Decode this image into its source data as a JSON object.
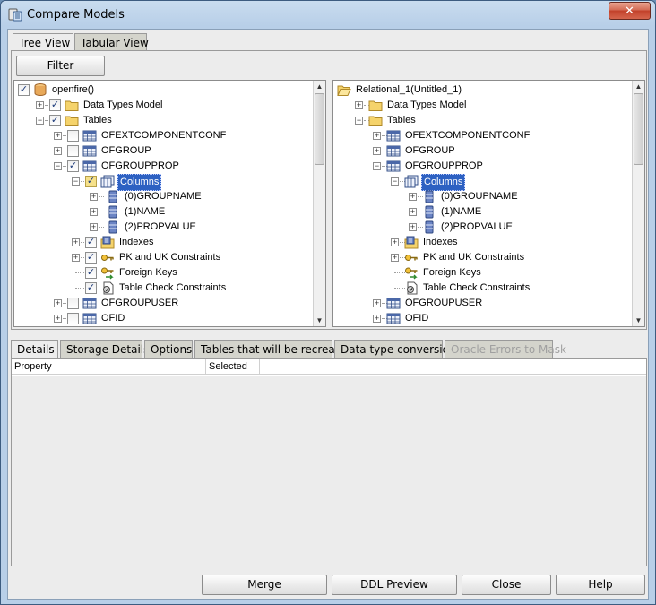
{
  "window": {
    "title": "Compare Models",
    "close_label": "✕"
  },
  "top_tabs": [
    {
      "label": "Tree View",
      "active": true
    },
    {
      "label": "Tabular View",
      "active": false
    }
  ],
  "filter_label": "Filter",
  "left_tree": [
    {
      "label": "openfire()",
      "check": "checked",
      "icon": "db-icon"
    },
    {
      "label": "Data Types Model",
      "check": "checked",
      "icon": "folder-icon"
    },
    {
      "label": "Tables",
      "check": "checked",
      "icon": "folder-icon"
    },
    {
      "label": "OFEXTCOMPONENTCONF",
      "check": "unchecked",
      "icon": "table-icon"
    },
    {
      "label": "OFGROUP",
      "check": "unchecked",
      "icon": "table-icon"
    },
    {
      "label": "OFGROUPPROP",
      "check": "checked",
      "icon": "table-icon"
    },
    {
      "label": "Columns",
      "check": "checked-yellow",
      "icon": "columns-icon",
      "selected": true
    },
    {
      "label": "(0)GROUPNAME",
      "icon": "column-icon"
    },
    {
      "label": "(1)NAME",
      "icon": "column-icon"
    },
    {
      "label": "(2)PROPVALUE",
      "icon": "column-icon"
    },
    {
      "label": "Indexes",
      "check": "checked",
      "icon": "index-icon"
    },
    {
      "label": "PK and UK Constraints",
      "check": "checked",
      "icon": "key-icon"
    },
    {
      "label": "Foreign Keys",
      "check": "checked",
      "icon": "foreign-key-icon"
    },
    {
      "label": "Table Check Constraints",
      "check": "checked",
      "icon": "check-constraint-icon"
    },
    {
      "label": "OFGROUPUSER",
      "check": "unchecked",
      "icon": "table-icon"
    },
    {
      "label": "OFID",
      "check": "unchecked",
      "icon": "table-icon"
    }
  ],
  "right_tree": [
    {
      "label": "Relational_1(Untitled_1)",
      "icon": "open-folder-icon"
    },
    {
      "label": "Data Types Model",
      "icon": "folder-icon"
    },
    {
      "label": "Tables",
      "icon": "folder-icon"
    },
    {
      "label": "OFEXTCOMPONENTCONF",
      "icon": "table-icon"
    },
    {
      "label": "OFGROUP",
      "icon": "table-icon"
    },
    {
      "label": "OFGROUPPROP",
      "icon": "table-icon"
    },
    {
      "label": "Columns",
      "icon": "columns-icon",
      "selected": true
    },
    {
      "label": "(0)GROUPNAME",
      "icon": "column-icon"
    },
    {
      "label": "(1)NAME",
      "icon": "column-icon"
    },
    {
      "label": "(2)PROPVALUE",
      "icon": "column-icon"
    },
    {
      "label": "Indexes",
      "icon": "index-icon"
    },
    {
      "label": "PK and UK Constraints",
      "icon": "key-icon"
    },
    {
      "label": "Foreign Keys",
      "icon": "foreign-key-icon"
    },
    {
      "label": "Table Check Constraints",
      "icon": "check-constraint-icon"
    },
    {
      "label": "OFGROUPUSER",
      "icon": "table-icon"
    },
    {
      "label": "OFID",
      "icon": "table-icon"
    }
  ],
  "bottom_tabs": [
    {
      "label": "Details",
      "active": true
    },
    {
      "label": "Storage Details"
    },
    {
      "label": "Options"
    },
    {
      "label": "Tables that will be recreated"
    },
    {
      "label": "Data type conversion"
    },
    {
      "label": "Oracle Errors to Mask",
      "disabled": true
    }
  ],
  "details_grid": {
    "columns": [
      "Property",
      "Selected",
      "",
      ""
    ]
  },
  "footer_buttons": {
    "merge": "Merge",
    "ddl_preview": "DDL Preview",
    "close": "Close",
    "help": "Help"
  },
  "colors": {
    "selection": "#2d61c2",
    "title_gradient": "#b8cfe8",
    "close_red": "#c2412a"
  }
}
